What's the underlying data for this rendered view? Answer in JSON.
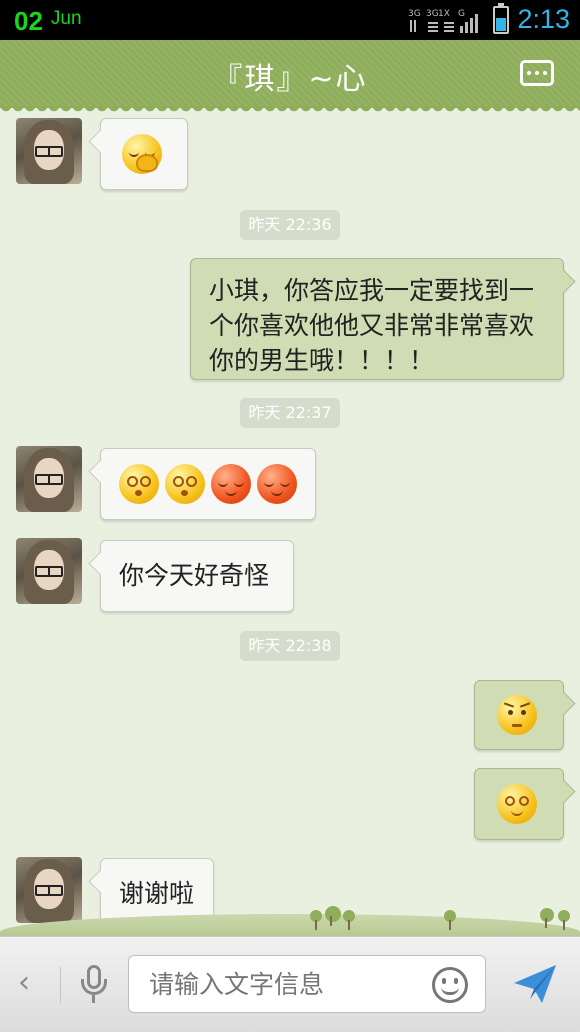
{
  "status_bar": {
    "day": "02",
    "month": "Jun",
    "time": "2:13",
    "network_icons": "3G 3G 1X G signal-icon",
    "battery": "battery-icon",
    "battery_level": 0.6
  },
  "header": {
    "title": "『琪』~心",
    "menu_icon": "more-icon"
  },
  "messages": [
    {
      "type": "incoming",
      "content": "emoji",
      "emojis": [
        "embarrassed-emoji"
      ]
    },
    {
      "type": "timestamp",
      "text": "昨天 22:36"
    },
    {
      "type": "outgoing",
      "text": "小琪，你答应我一定要找到一个你喜欢他他又非常非常喜欢你的男生哦！！！！"
    },
    {
      "type": "timestamp",
      "text": "昨天 22:37"
    },
    {
      "type": "incoming",
      "content": "emoji",
      "emojis": [
        "dizzy-emoji",
        "dizzy-emoji",
        "shy-emoji",
        "shy-emoji"
      ]
    },
    {
      "type": "incoming",
      "text": "你今天好奇怪"
    },
    {
      "type": "timestamp",
      "text": "昨天 22:38"
    },
    {
      "type": "outgoing",
      "content": "emoji",
      "emojis": [
        "annoyed-emoji"
      ]
    },
    {
      "type": "outgoing",
      "content": "emoji",
      "emojis": [
        "confused-emoji"
      ]
    },
    {
      "type": "incoming",
      "text": "谢谢啦"
    }
  ],
  "input": {
    "placeholder": "请输入文字信息",
    "back_icon": "back-icon",
    "mic_icon": "microphone-icon",
    "emoji_icon": "smiley-icon",
    "send_icon": "send-icon"
  },
  "colors": {
    "header": "#8fae5c",
    "outgoing_bubble": "#cfdcb4",
    "incoming_bubble": "#f7f7f5",
    "background": "#e9f0df",
    "time_accent": "#33b5e5",
    "date_accent": "#1bd41b"
  }
}
